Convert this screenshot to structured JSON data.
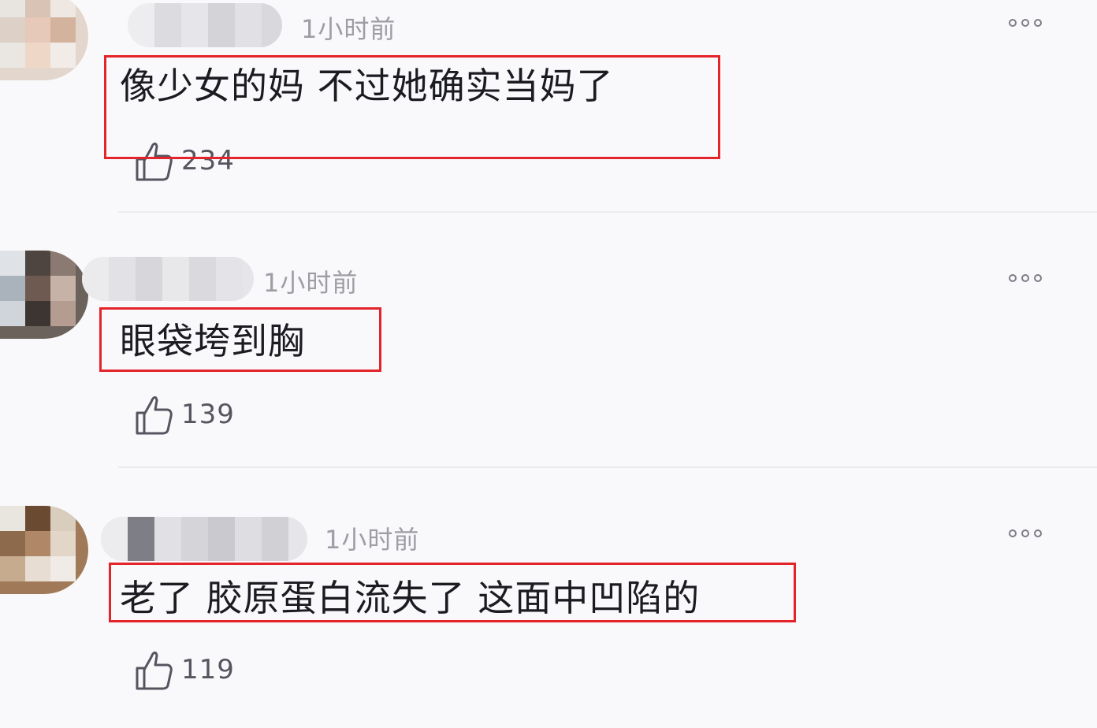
{
  "comments": [
    {
      "time": "1小时前",
      "text": "像少女的妈 不过她确实当妈了",
      "likes": "234"
    },
    {
      "time": "1小时前",
      "text": "眼袋垮到胸",
      "likes": "139"
    },
    {
      "time": "1小时前",
      "text": "老了 胶原蛋白流失了 这面中凹陷的",
      "likes": "119"
    }
  ],
  "icons": {
    "like": "thumbs-up-icon",
    "more": "more-options-icon"
  },
  "colors": {
    "highlight_border": "#e3242b",
    "time_text": "#9d9da5",
    "comment_text": "#1b1b22"
  }
}
